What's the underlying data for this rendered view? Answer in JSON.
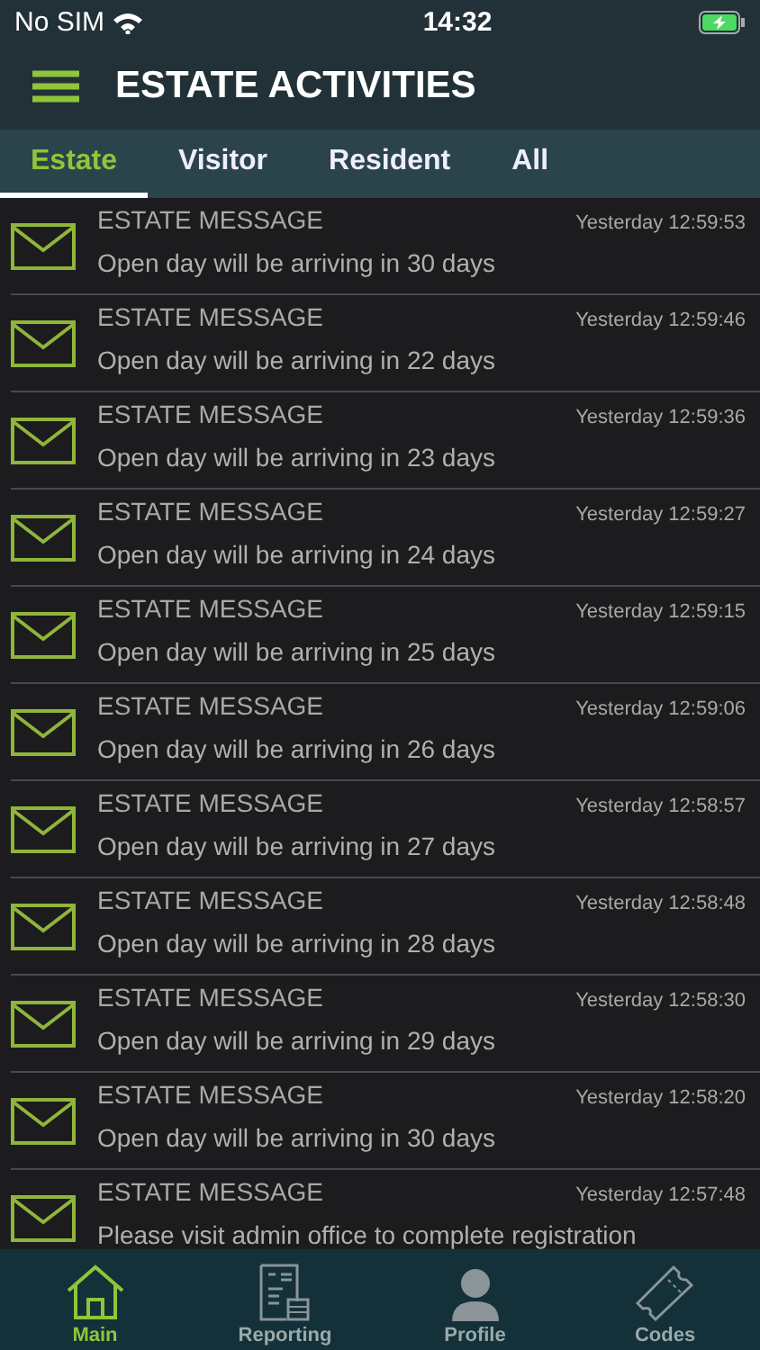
{
  "status_bar": {
    "carrier": "No SIM",
    "time": "14:32"
  },
  "header": {
    "title": "ESTATE ACTIVITIES"
  },
  "tabs": [
    {
      "label": "Estate",
      "selected": true
    },
    {
      "label": "Visitor",
      "selected": false
    },
    {
      "label": "Resident",
      "selected": false
    },
    {
      "label": "All",
      "selected": false
    }
  ],
  "messages": [
    {
      "title": "ESTATE MESSAGE",
      "time": "Yesterday 12:59:53",
      "text": "Open day will be arriving in 30 days"
    },
    {
      "title": "ESTATE MESSAGE",
      "time": "Yesterday 12:59:46",
      "text": "Open day will be arriving in 22 days"
    },
    {
      "title": "ESTATE MESSAGE",
      "time": "Yesterday 12:59:36",
      "text": "Open day will be arriving in 23 days"
    },
    {
      "title": "ESTATE MESSAGE",
      "time": "Yesterday 12:59:27",
      "text": "Open day will be arriving in 24 days"
    },
    {
      "title": "ESTATE MESSAGE",
      "time": "Yesterday 12:59:15",
      "text": "Open day will be arriving in 25 days"
    },
    {
      "title": "ESTATE MESSAGE",
      "time": "Yesterday 12:59:06",
      "text": "Open day will be arriving in 26 days"
    },
    {
      "title": "ESTATE MESSAGE",
      "time": "Yesterday 12:58:57",
      "text": "Open day will be arriving in 27 days"
    },
    {
      "title": "ESTATE MESSAGE",
      "time": "Yesterday 12:58:48",
      "text": "Open day will be arriving in 28 days"
    },
    {
      "title": "ESTATE MESSAGE",
      "time": "Yesterday 12:58:30",
      "text": "Open day will be arriving in 29 days"
    },
    {
      "title": "ESTATE MESSAGE",
      "time": "Yesterday 12:58:20",
      "text": "Open day will be arriving in 30 days"
    },
    {
      "title": "ESTATE MESSAGE",
      "time": "Yesterday 12:57:48",
      "text": "Please visit admin office to complete registration"
    }
  ],
  "nav": [
    {
      "kind": "home",
      "label": "Main",
      "selected": true
    },
    {
      "kind": "report",
      "label": "Reporting",
      "selected": false
    },
    {
      "kind": "profile",
      "label": "Profile",
      "selected": false
    },
    {
      "kind": "ticket",
      "label": "Codes",
      "selected": false
    }
  ]
}
